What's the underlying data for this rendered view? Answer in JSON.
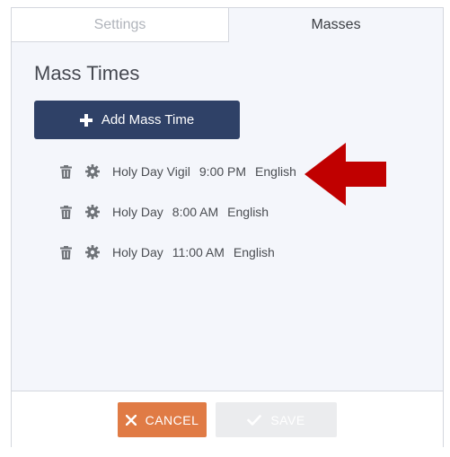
{
  "tabs": [
    {
      "label": "Settings",
      "active": false
    },
    {
      "label": "Masses",
      "active": true
    }
  ],
  "section": {
    "title": "Mass Times",
    "add_button_label": "Add Mass Time"
  },
  "masses": [
    {
      "name": "Holy Day Vigil",
      "time": "9:00 PM",
      "language": "English"
    },
    {
      "name": "Holy Day",
      "time": "8:00 AM",
      "language": "English"
    },
    {
      "name": "Holy Day",
      "time": "11:00 AM",
      "language": "English"
    }
  ],
  "footer": {
    "cancel_label": "CANCEL",
    "save_label": "SAVE",
    "save_enabled": false
  },
  "icons": {
    "add": "plus-icon",
    "delete": "trash-icon",
    "edit": "gear-icon",
    "cancel": "x-icon",
    "save": "check-icon",
    "annotation": "red-arrow"
  },
  "colors": {
    "primary": "#2f4167",
    "cancel": "#e07b45",
    "disabled": "#ebecee",
    "annotation_arrow": "#c00000"
  }
}
